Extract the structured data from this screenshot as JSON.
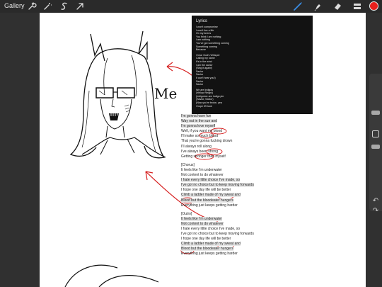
{
  "toolbar": {
    "gallery_label": "Gallery",
    "tools": [
      "wrench-icon",
      "magic-wand-icon",
      "selection-s-icon",
      "transform-arrow-icon"
    ],
    "right_tools": [
      "brush-icon",
      "smudge-icon",
      "eraser-icon",
      "layers-icon"
    ],
    "active_color": "#e8201c",
    "active_tool_color": "#3a8ee6"
  },
  "annotation_label": "Me",
  "lyrics_panel": {
    "title": "Lyrics",
    "lines": [
      "I won't compromise",
      "I won't live a life",
      "On my knees",
      "You think I am nothing",
      "I am nothing",
      "You've got something coming",
      "Something coming",
      "Because",
      "",
      "I hear God's Whisper",
      "Calling my name",
      "It's in the wind",
      "I am the savior",
      "(Sing it again!)",
      "Savior",
      "Savior",
      "It can't hear you!)",
      "Savior",
      "Savior",
      "",
      "We are Indigos",
      "(Yellow Reign!)",
      "(Indigo/we are Indigo pie",
      "(Savior, Savior)",
      "(Now you're broke, yea",
      "I hope it'll look"
    ]
  },
  "lyrics_white": {
    "lines": [
      {
        "text": "I'm gonna have fun",
        "hl": true
      },
      {
        "text": "Way out in the sun and",
        "hl": true
      },
      {
        "text": "I'm gonna love myself",
        "hl": true
      },
      {
        "text": "Well, if you want my blood",
        "hl": false
      },
      {
        "text": "I'll make so much blood",
        "hl": false
      },
      {
        "text": "That you're gonna fucking drown",
        "hl": false
      },
      {
        "text": "I'll always roll along",
        "hl": false
      },
      {
        "text": "I've always been strong",
        "hl": false
      },
      {
        "text": "Getting stronger than myself",
        "hl": false
      },
      {
        "text": "",
        "hl": false
      },
      {
        "text": "[Chorus]",
        "hl": false
      },
      {
        "text": "It feels like I'm underwater",
        "hl": false
      },
      {
        "text": "Not content to do whatever",
        "hl": false
      },
      {
        "text": "I hate every little choice I've made, so",
        "hl": true
      },
      {
        "text": "I've got no choice but to keep moving forwards",
        "hl": true
      },
      {
        "text": "I hope one day life will be better",
        "hl": false
      },
      {
        "text": "Climb a ladder made of my sweat and",
        "hl": true
      },
      {
        "text": "Blood but the bloodeater hungers",
        "hl": true
      },
      {
        "text": "Everything just keeps getting harder",
        "hl": false
      },
      {
        "text": "",
        "hl": false
      },
      {
        "text": "[Outro]",
        "hl": false
      },
      {
        "text": "It feels like I'm underwater",
        "hl": true
      },
      {
        "text": "Not content to do whatever",
        "hl": true
      },
      {
        "text": "I hate every little choice I've made, so",
        "hl": false
      },
      {
        "text": "I've got no choice but to keep moving forwards",
        "hl": false
      },
      {
        "text": "I hope one day life will be better",
        "hl": false
      },
      {
        "text": "Climb a ladder made of my sweat and",
        "hl": true
      },
      {
        "text": "Blood but the bloodeater hungers",
        "hl": true
      },
      {
        "text": "Everything just keeps getting harder",
        "hl": false
      }
    ]
  },
  "sidebar": {
    "icons": [
      "undo-icon",
      "redo-icon"
    ]
  }
}
